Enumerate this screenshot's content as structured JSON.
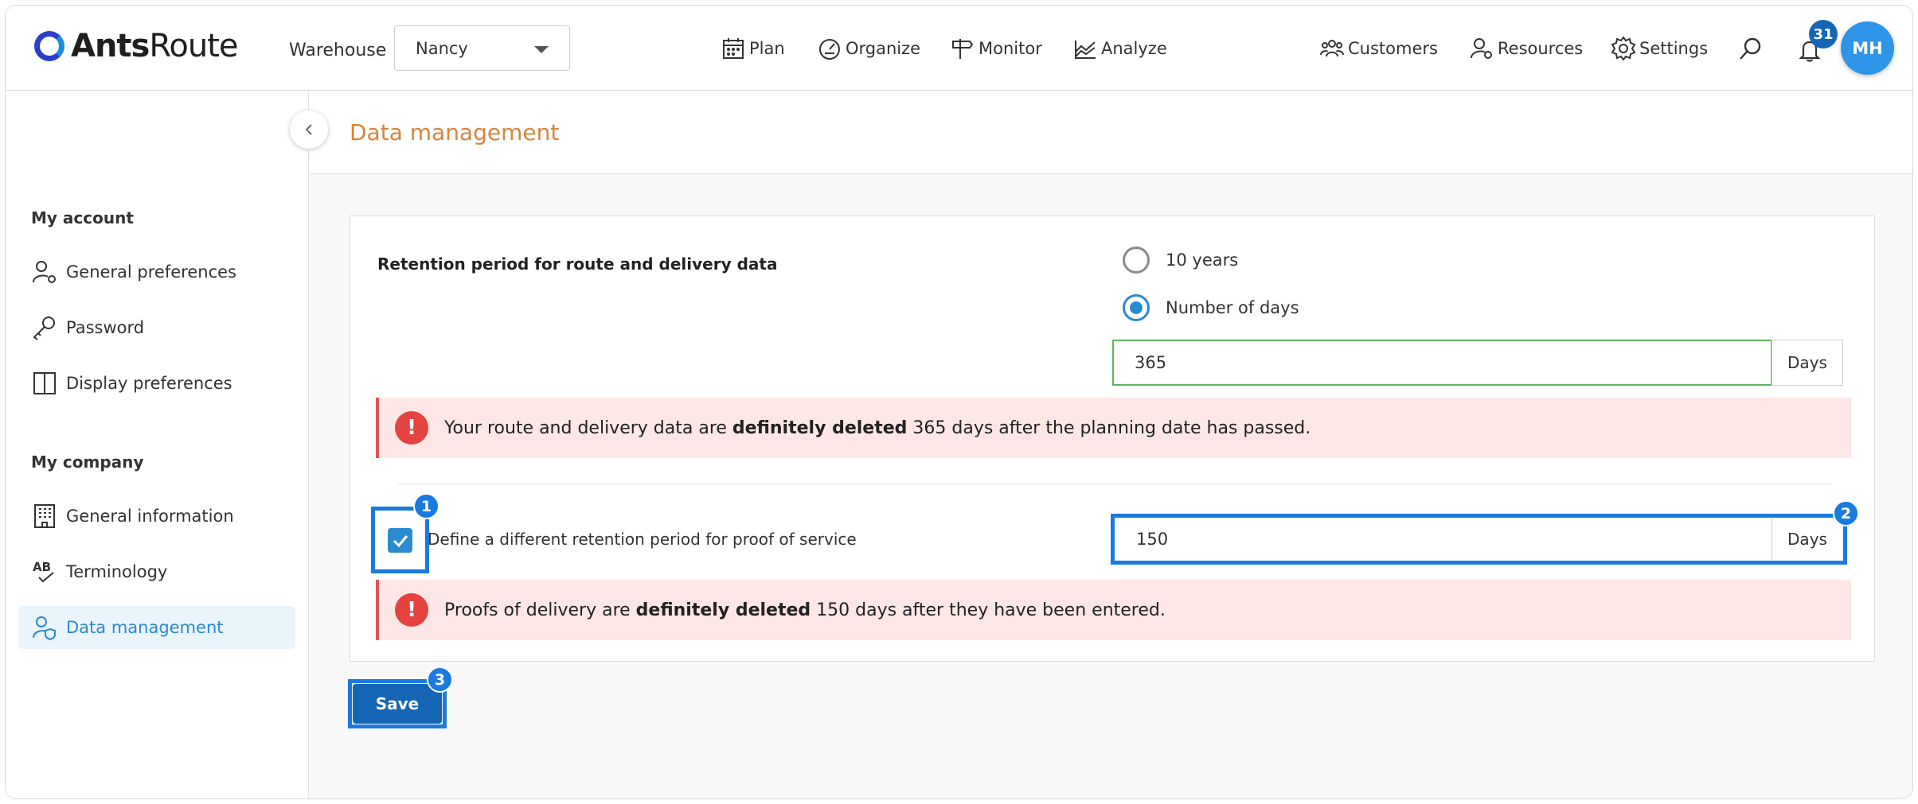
{
  "header": {
    "logo": {
      "bold": "Ants",
      "light": "Route"
    },
    "warehouse_label": "Warehouse",
    "warehouse_value": "Nancy",
    "nav": [
      {
        "label": "Plan",
        "icon": "calendar-icon"
      },
      {
        "label": "Organize",
        "icon": "speedometer-icon"
      },
      {
        "label": "Monitor",
        "icon": "signpost-icon"
      },
      {
        "label": "Analyze",
        "icon": "chart-icon"
      }
    ],
    "right_nav": [
      {
        "label": "Customers",
        "icon": "customers-icon"
      },
      {
        "label": "Resources",
        "icon": "resources-icon"
      },
      {
        "label": "Settings",
        "icon": "gear-icon"
      }
    ],
    "notification_count": "31",
    "avatar_initials": "MH"
  },
  "sidebar": {
    "my_account_title": "My account",
    "account_items": [
      {
        "label": "General preferences",
        "icon": "user-gear-icon"
      },
      {
        "label": "Password",
        "icon": "key-icon"
      },
      {
        "label": "Display preferences",
        "icon": "columns-icon"
      }
    ],
    "my_company_title": "My company",
    "company_items": [
      {
        "label": "General information",
        "icon": "building-icon"
      },
      {
        "label": "Terminology",
        "icon": "abc-check-icon"
      },
      {
        "label": "Data management",
        "icon": "user-shield-icon",
        "active": true
      }
    ]
  },
  "page": {
    "title": "Data management",
    "retention_label": "Retention period for route and delivery data",
    "options": [
      "10 years",
      "Number of days"
    ],
    "selected_option": "Number of days",
    "days_value": "365",
    "days_unit": "Days",
    "alert1": {
      "pre": "Your route and delivery data are ",
      "bold": "definitely deleted",
      "post": " 365 days after the planning date has passed."
    },
    "pos_checkbox_label": "Define a different retention period for proof of service",
    "pos_checked": true,
    "pos_days_value": "150",
    "pos_days_unit": "Days",
    "alert2": {
      "pre": "Proofs of delivery are ",
      "bold": "definitely deleted",
      "post": " 150 days after they have been entered."
    },
    "save_label": "Save",
    "step_badges": [
      "1",
      "2",
      "3"
    ]
  },
  "colors": {
    "accent": "#2a8bd0",
    "highlight": "#1a7ae0",
    "title": "#d9843a",
    "alert_bg": "#fde6e6",
    "alert_icon": "#e5433f"
  }
}
